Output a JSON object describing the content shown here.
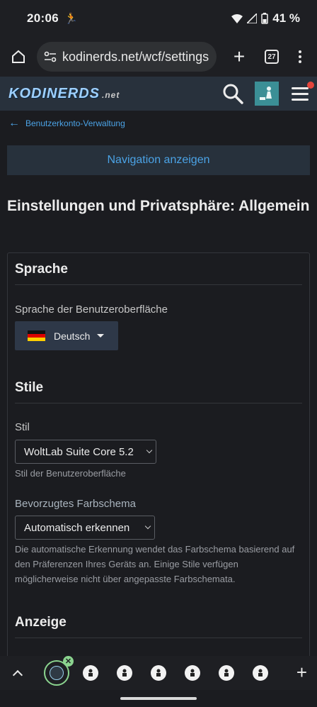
{
  "status_bar": {
    "time": "20:06",
    "battery": "41 %"
  },
  "browser": {
    "url": "kodinerds.net/wcf/settings",
    "tab_count": "27"
  },
  "site": {
    "logo_text": "KODINERDS",
    "logo_suffix": ".net"
  },
  "breadcrumb": {
    "label": "Benutzerkonto-Verwaltung"
  },
  "nav_button": {
    "label": "Navigation anzeigen"
  },
  "page": {
    "title": "Einstellungen und Privatsphäre: Allgemein"
  },
  "sections": {
    "language": {
      "title": "Sprache",
      "field_label": "Sprache der Benutzeroberfläche",
      "selected": "Deutsch"
    },
    "styles": {
      "title": "Stile",
      "style_label": "Stil",
      "style_value": "WoltLab Suite Core 5.2",
      "style_help": "Stil der Benutzeroberfläche",
      "scheme_label": "Bevorzugtes Farbschema",
      "scheme_value": "Automatisch erkennen",
      "scheme_help": "Die automatische Erkennung wendet das Farbschema basierend auf den Präferenzen Ihres Geräts an. Einige Stile verfügen möglicherweise nicht über angepasste Farbschemata."
    },
    "display": {
      "title": "Anzeige"
    }
  },
  "colors": {
    "accent": "#4ba3e6",
    "header_bg": "#28313c",
    "page_bg": "#1b1c20"
  }
}
